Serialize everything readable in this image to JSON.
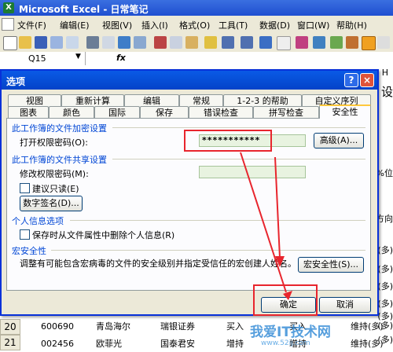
{
  "window": {
    "title": "Microsoft Excel - 日常笔记"
  },
  "menu": [
    "文件(F)",
    "编辑(E)",
    "视图(V)",
    "插入(I)",
    "格式(O)",
    "工具(T)",
    "数据(D)",
    "窗口(W)",
    "帮助(H)"
  ],
  "formula_bar": {
    "name_box": "Q15",
    "fx": "fx"
  },
  "sheet": {
    "rows": [
      {
        "num": "20",
        "c1": "600690",
        "c2": "青岛海尔",
        "c3": "瑞银证券",
        "c4": "买入",
        "c5": "买入",
        "c6": "维持(多)"
      },
      {
        "num": "21",
        "c1": "002456",
        "c2": "欧菲光",
        "c3": "国泰君安",
        "c4": "增持",
        "c5": "增持",
        "c6": "维持(多)"
      }
    ],
    "right_fragments": [
      "H",
      "设",
      "0%位",
      "方向",
      "(多)",
      "(多)",
      "(多)",
      "(多)",
      "(多)",
      "(多)",
      "(多)"
    ]
  },
  "dialog": {
    "title": "选项",
    "help": "?",
    "close": "×",
    "tabs_row1": [
      "视图",
      "重新计算",
      "编辑",
      "常规",
      "1-2-3 的帮助",
      "自定义序列"
    ],
    "tabs_row2": [
      "图表",
      "颜色",
      "国际",
      "保存",
      "错误检查",
      "拼写检查",
      "安全性"
    ],
    "encrypt_group": "此工作簿的文件加密设置",
    "open_password_label": "打开权限密码(O):",
    "open_password_value": "***********",
    "advanced_button": "高级(A)...",
    "share_group": "此工作簿的文件共享设置",
    "modify_password_label": "修改权限密码(M):",
    "readonly_label": "建议只读(E)",
    "digital_sign_button": "数字签名(D)...",
    "privacy_group": "个人信息选项",
    "remove_info_label": "保存时从文件属性中删除个人信息(R)",
    "macro_group": "宏安全性",
    "macro_desc": "调整有可能包含宏病毒的文件的安全级别并指定受信任的宏创建人姓名。",
    "macro_button": "宏安全性(S)...",
    "ok_button": "确定",
    "cancel_button": "取消"
  },
  "watermark": {
    "text": "我爱IT技术网",
    "url": "www.52ij.com"
  },
  "colors": {
    "dialog_border": "#0831d9",
    "group_text": "#0046d5",
    "highlight": "#e8252d"
  }
}
